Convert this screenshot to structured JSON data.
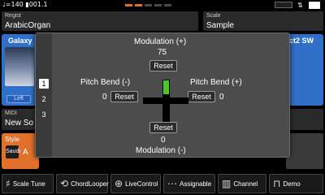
{
  "topbar": {
    "tempo": "♩=140",
    "bar_beat": "001.1",
    "segment_colors": [
      "#e0702a",
      "#e0702a",
      "#4a4a4a",
      "#4a4a4a",
      "#4a4a4a"
    ]
  },
  "regist": {
    "label": "Regist",
    "value": "ArabicOrgan"
  },
  "scale": {
    "label": "Scale",
    "value": "Sample"
  },
  "voice_left": {
    "title": "Galaxy",
    "badge": "Left"
  },
  "voice_right": {
    "title": "ct2 SW"
  },
  "midi": {
    "label": "MIDI",
    "value": "New So"
  },
  "style": {
    "label": "Style",
    "icon_text": "Saudi",
    "value_prefix": "A"
  },
  "popup": {
    "tabs": [
      "1",
      "2",
      "3"
    ],
    "active_tab": 0,
    "modulation_plus_label": "Modulation (+)",
    "modulation_plus_value": "75",
    "pitch_bend_minus_label": "Pitch Bend (-)",
    "pitch_bend_minus_value": "0",
    "pitch_bend_plus_label": "Pitch Bend (+)",
    "pitch_bend_plus_value": "0",
    "modulation_minus_label": "Modulation (-)",
    "modulation_minus_value": "0",
    "reset_label": "Reset",
    "indicator_color": "#4cc62a"
  },
  "toolbar": {
    "items": [
      {
        "label": "Scale Tune",
        "icon": "scale-tune-icon"
      },
      {
        "label": "ChordLooper",
        "icon": "chord-looper-icon"
      },
      {
        "label": "LiveControl",
        "icon": "live-control-icon"
      },
      {
        "label": "Assignable",
        "icon": "assignable-icon"
      },
      {
        "label": "Channel",
        "icon": "channel-icon"
      },
      {
        "label": "Demo",
        "icon": "demo-icon"
      }
    ]
  }
}
